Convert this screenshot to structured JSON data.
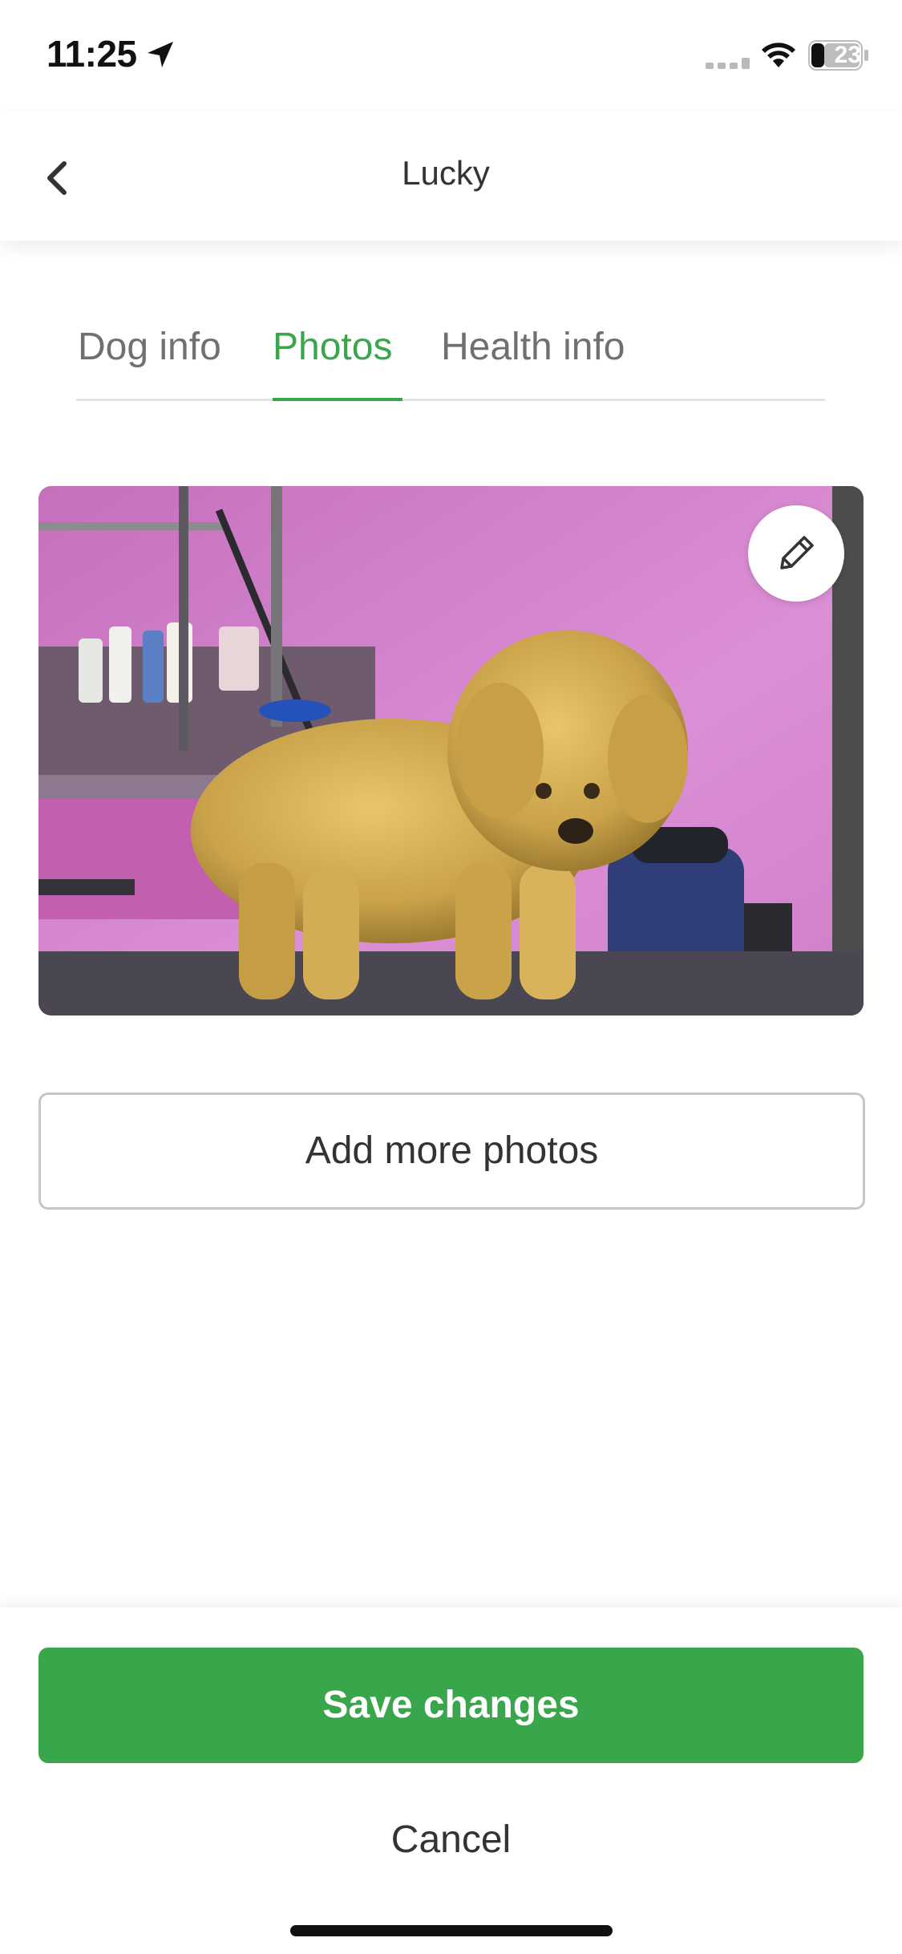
{
  "status_bar": {
    "time": "11:25",
    "battery_level": "23",
    "icons": [
      "location-arrow-icon",
      "cell-signal-icon",
      "wifi-icon",
      "battery-icon"
    ]
  },
  "nav": {
    "title": "Lucky",
    "back_icon": "chevron-left-icon"
  },
  "tabs": [
    {
      "label": "Dog info",
      "active": false
    },
    {
      "label": "Photos",
      "active": true
    },
    {
      "label": "Health info",
      "active": false
    }
  ],
  "photo": {
    "edit_icon": "pencil-icon"
  },
  "actions": {
    "add_photos_label": "Add more photos",
    "save_label": "Save changes",
    "cancel_label": "Cancel"
  },
  "colors": {
    "accent": "#3aa64b",
    "tab_inactive": "#707070",
    "text": "#333333",
    "border": "#c6c6c6"
  }
}
